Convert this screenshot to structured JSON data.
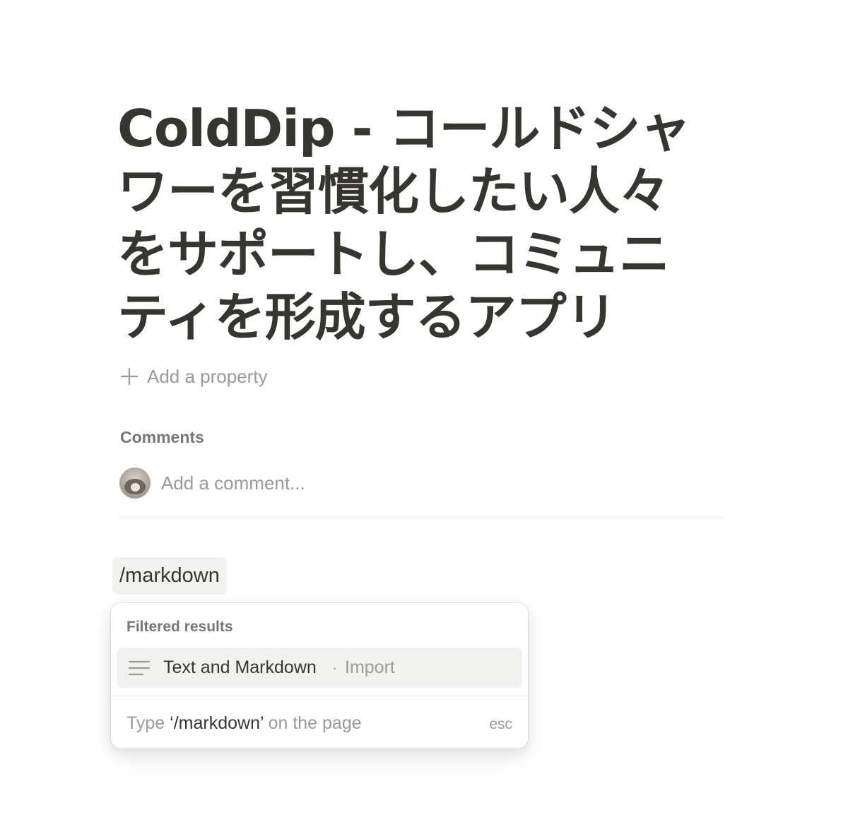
{
  "page": {
    "title": "ColdDip - コールドシャワーを習慣化したい人々をサポートし、コミュニティを形成するアプリ"
  },
  "properties": {
    "add_label": "Add a property",
    "add_icon": "plus-icon"
  },
  "comments": {
    "heading": "Comments",
    "placeholder": "Add a comment...",
    "avatar_icon": "user-avatar"
  },
  "editor": {
    "slash_query": "/markdown"
  },
  "slash_menu": {
    "heading": "Filtered results",
    "items": [
      {
        "icon": "text-lines-icon",
        "label": "Text and Markdown",
        "separator": "·",
        "type": "Import"
      }
    ],
    "footer": {
      "prefix": "Type ",
      "open_quote": "‘",
      "query": "/markdown",
      "close_quote": "’",
      "suffix": " on the page",
      "esc_label": "esc"
    }
  },
  "colors": {
    "text": "#37352f",
    "muted": "#9b9a97",
    "heading_muted": "#787774",
    "highlight": "#f1f1ef",
    "divider": "#e9e9e7",
    "background": "#ffffff"
  }
}
